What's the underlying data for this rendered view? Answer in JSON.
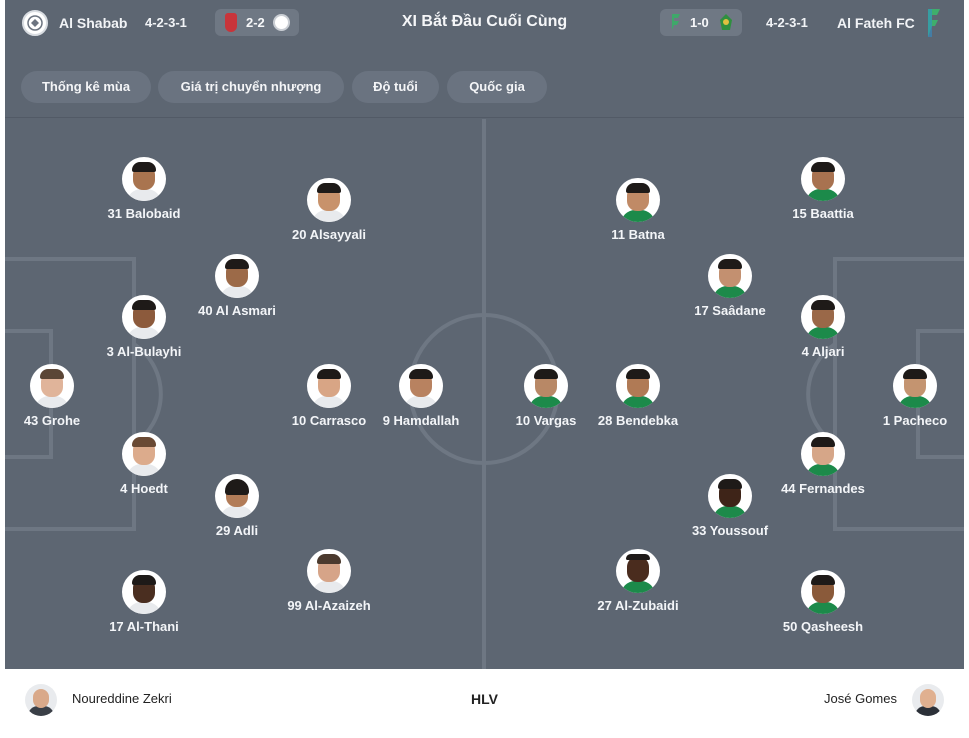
{
  "header": {
    "title": "XI Bắt Đầu Cuối Cùng",
    "home": {
      "name": "Al Shabab",
      "formation": "4-2-3-1",
      "crest_color": "#ffffff"
    },
    "home_previous": {
      "score": "2-2"
    },
    "away": {
      "name": "Al Fateh FC",
      "formation": "4-2-3-1"
    },
    "away_previous": {
      "score": "1-0"
    }
  },
  "tabs": [
    "Thống kê mùa",
    "Giá trị chuyển nhượng",
    "Độ tuổi",
    "Quốc gia"
  ],
  "home_players": [
    {
      "label": "31 Balobaid",
      "skin": "#a9744f",
      "shirt": "#ffffff"
    },
    {
      "label": "20 Alsayyali",
      "skin": "#c8926b",
      "shirt": "#ffffff"
    },
    {
      "label": "40 Al Asmari",
      "skin": "#9c6a48",
      "shirt": "#ffffff"
    },
    {
      "label": "3 Al-Bulayhi",
      "skin": "#8c5a3c",
      "shirt": "#ffffff"
    },
    {
      "label": "43 Grohe",
      "skin": "#e0b49a",
      "shirt": "#ffffff"
    },
    {
      "label": "10 Carrasco",
      "skin": "#d8a585",
      "shirt": "#ffffff"
    },
    {
      "label": "9 Hamdallah",
      "skin": "#b88260",
      "shirt": "#ffffff"
    },
    {
      "label": "4 Hoedt",
      "skin": "#dcab8c",
      "shirt": "#ffffff"
    },
    {
      "label": "29 Adli",
      "skin": "#b27c58",
      "shirt": "#ffffff"
    },
    {
      "label": "17 Al-Thani",
      "skin": "#4a2e20",
      "shirt": "#ffffff"
    },
    {
      "label": "99 Al-Azaizeh",
      "skin": "#d6a488",
      "shirt": "#ffffff"
    }
  ],
  "away_players": [
    {
      "label": "11 Batna",
      "skin": "#c08a66",
      "shirt": "#1c8a4a"
    },
    {
      "label": "15 Baattia",
      "skin": "#a87250",
      "shirt": "#1c8a4a"
    },
    {
      "label": "17 Saâdane",
      "skin": "#c39070",
      "shirt": "#1c8a4a"
    },
    {
      "label": "4 Aljari",
      "skin": "#9a6848",
      "shirt": "#1c8a4a"
    },
    {
      "label": "10 Vargas",
      "skin": "#b88866",
      "shirt": "#1c8a4a"
    },
    {
      "label": "28 Bendebka",
      "skin": "#b07a55",
      "shirt": "#1c8a4a"
    },
    {
      "label": "1 Pacheco",
      "skin": "#c49470",
      "shirt": "#1c8a4a"
    },
    {
      "label": "44 Fernandes",
      "skin": "#d6a688",
      "shirt": "#1c8a4a"
    },
    {
      "label": "33 Youssouf",
      "skin": "#3e2418",
      "shirt": "#1c8a4a"
    },
    {
      "label": "27 Al-Zubaidi",
      "skin": "#4a2c1e",
      "shirt": "#1c8a4a"
    },
    {
      "label": "50 Qasheesh",
      "skin": "#8a5a3a",
      "shirt": "#1c8a4a"
    }
  ],
  "coaches": {
    "label": "HLV",
    "home": "Noureddine Zekri",
    "away": "José Gomes"
  },
  "colors": {
    "panel": "#5d6672",
    "pitch_lines": "#6e7783",
    "home_kit": "#ffffff",
    "away_kit": "#1c8a4a"
  }
}
